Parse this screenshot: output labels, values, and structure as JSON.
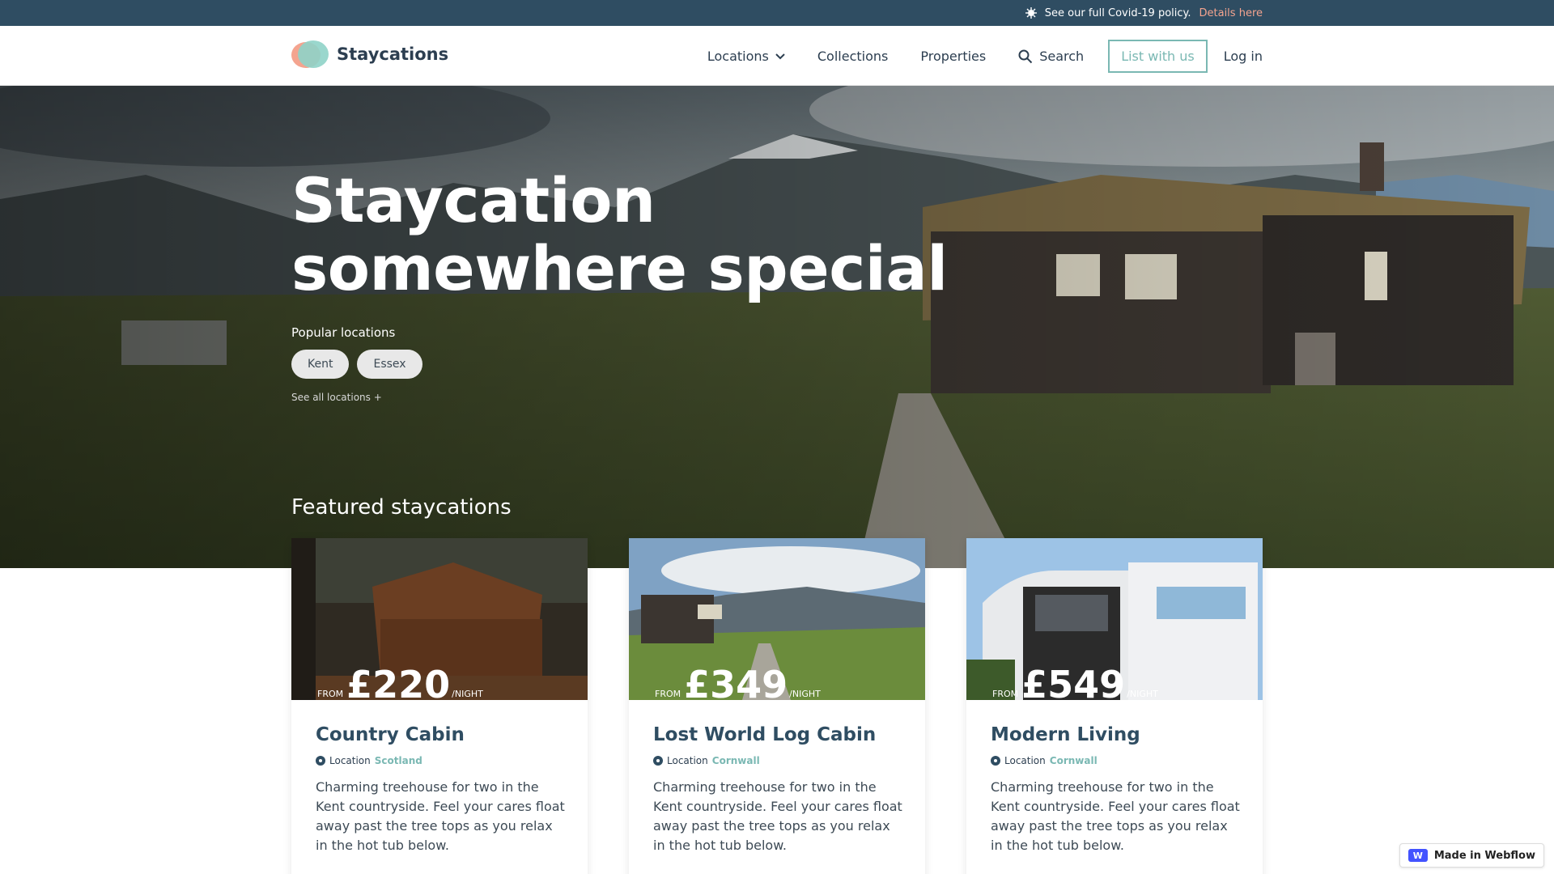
{
  "topbar": {
    "text": "See our full Covid-19 policy.",
    "link": "Details here"
  },
  "nav": {
    "brand": "Staycations",
    "items": [
      {
        "label": "Locations"
      },
      {
        "label": "Collections"
      },
      {
        "label": "Properties"
      },
      {
        "label": "Search"
      }
    ],
    "list_button": "List with us",
    "login": "Log in"
  },
  "hero": {
    "title_line1": "Staycation",
    "title_line2": "somewhere special",
    "popular_label": "Popular locations",
    "chips": [
      "Kent",
      "Essex"
    ],
    "see_all": "See all locations +"
  },
  "featured": {
    "title": "Featured staycations",
    "cards": [
      {
        "from": "FROM",
        "price": "£220",
        "per": "/NIGHT",
        "title": "Country Cabin",
        "location_label": "Location",
        "location": "Scotland",
        "description": "Charming treehouse for two in the Kent countryside. Feel your cares float away past the tree tops as you relax in the hot tub below."
      },
      {
        "from": "FROM",
        "price": "£349",
        "per": "/NIGHT",
        "title": "Lost World Log Cabin",
        "location_label": "Location",
        "location": "Cornwall",
        "description": "Charming treehouse for two in the Kent countryside. Feel your cares float away past the tree tops as you relax in the hot tub below."
      },
      {
        "from": "FROM",
        "price": "£549",
        "per": "/NIGHT",
        "title": "Modern Living",
        "location_label": "Location",
        "location": "Cornwall",
        "description": "Charming treehouse for two in the Kent countryside. Feel your cares float away past the tree tops as you relax in the hot tub below."
      }
    ]
  },
  "webflow_badge": "Made in Webflow",
  "colors": {
    "topbar": "#2f4d62",
    "accent": "#7ab8b3",
    "link": "#f4a48f"
  }
}
